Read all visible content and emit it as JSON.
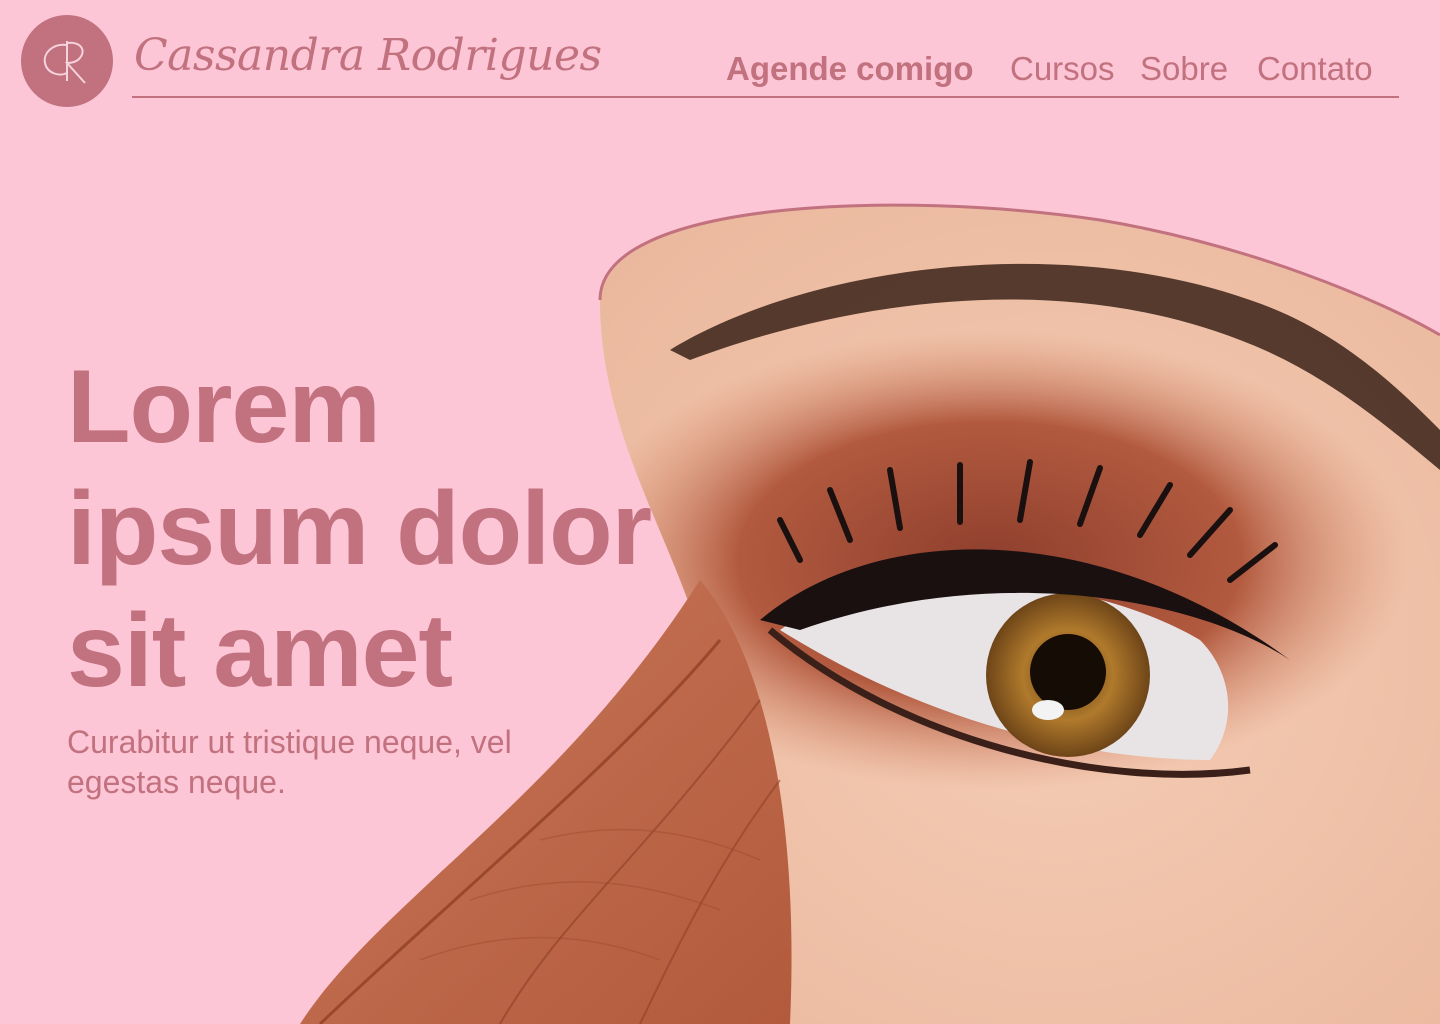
{
  "brand": {
    "monogram": "CR",
    "name": "Cassandra Rodrigues"
  },
  "nav": {
    "items": [
      {
        "label": "Agende comigo",
        "primary": true
      },
      {
        "label": "Cursos"
      },
      {
        "label": "Sobre"
      },
      {
        "label": "Contato"
      }
    ]
  },
  "hero": {
    "title": "Lorem ipsum dolor sit amet",
    "subtitle": "Curabitur ut tristique neque, vel egestas neque.",
    "image_icon": "eye-makeup-photo"
  },
  "colors": {
    "background": "#fcc6d6",
    "accent": "#c2717f",
    "skin": "#f0c2aa",
    "eyeshadow": "#b0573f",
    "leaf": "#c06a4e"
  }
}
